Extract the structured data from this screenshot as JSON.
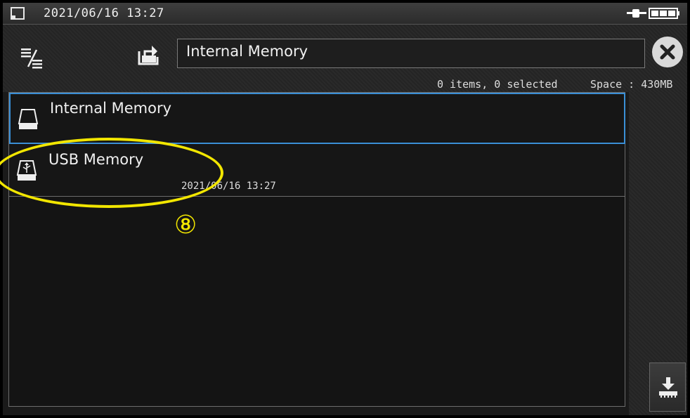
{
  "status_bar": {
    "datetime": "2021/06/16 13:27",
    "left_icon": "device-icon",
    "right_icon": "ac-power-battery-icon"
  },
  "header": {
    "menu_icon": "list-menu-icon",
    "up_icon": "parent-folder-icon",
    "path": "Internal Memory",
    "close_icon": "close-icon",
    "item_count": "0 items, 0 selected",
    "space": "Space : 430MB"
  },
  "list": {
    "items": [
      {
        "name": "Internal Memory",
        "date": "",
        "icon": "internal-drive-icon",
        "selected": true
      },
      {
        "name": "USB Memory",
        "date": "2021/06/16 13:27",
        "icon": "usb-drive-icon",
        "selected": false
      }
    ]
  },
  "side_panel": {
    "save_icon": "save-to-media-icon"
  },
  "annotation": {
    "marker": "⑧",
    "color": "#f2e600"
  },
  "colors": {
    "selection": "#3a8fd6",
    "background": "#1a1a1a",
    "annotation": "#f2e600"
  }
}
